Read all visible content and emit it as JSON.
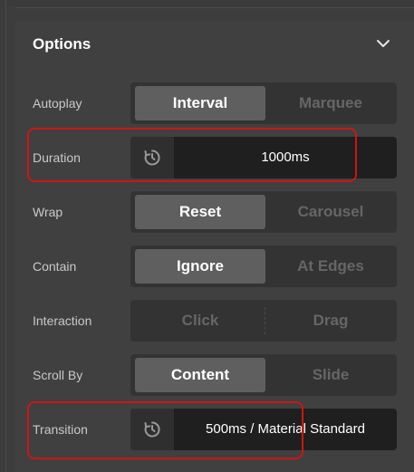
{
  "header": {
    "title": "Options",
    "collapse_icon": "chevron-down-icon"
  },
  "rows": {
    "autoplay": {
      "label": "Autoplay",
      "options": [
        "Interval",
        "Marquee"
      ],
      "selected": "Interval"
    },
    "duration": {
      "label": "Duration",
      "value": "1000ms",
      "icon": "reset-icon"
    },
    "wrap": {
      "label": "Wrap",
      "options": [
        "Reset",
        "Carousel"
      ],
      "selected": "Reset"
    },
    "contain": {
      "label": "Contain",
      "options": [
        "Ignore",
        "At Edges"
      ],
      "selected": "Ignore"
    },
    "interaction": {
      "label": "Interaction",
      "options": [
        "Click",
        "Drag"
      ],
      "selected": ""
    },
    "scroll_by": {
      "label": "Scroll By",
      "options": [
        "Content",
        "Slide"
      ],
      "selected": "Content"
    },
    "transition": {
      "label": "Transition",
      "value": "500ms / Material Standard",
      "icon": "reset-icon"
    }
  },
  "colors": {
    "background": "#3d3d3d",
    "panel": "#404040",
    "segment_track": "#333333",
    "segment_active": "#5f5f5f",
    "field": "#1f1f1f",
    "highlight": "#d01414"
  }
}
